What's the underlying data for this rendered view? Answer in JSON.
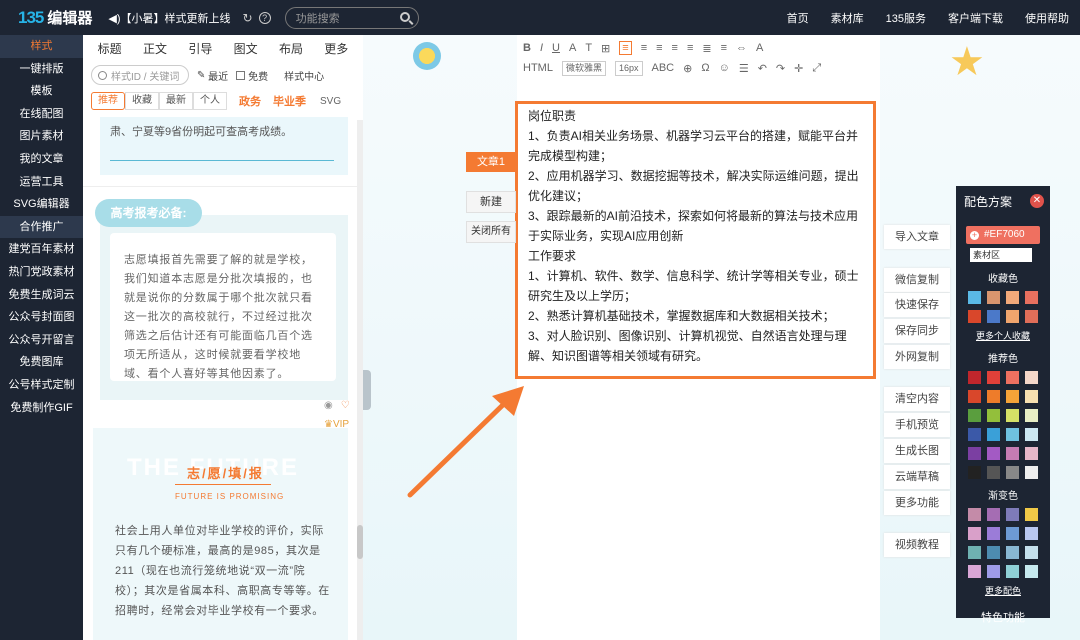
{
  "topbar": {
    "logo_mark": "135",
    "logo_text": "编辑器",
    "notice": "◀)【小暑】样式更新上线",
    "refresh": "↻",
    "help": "?",
    "search_placeholder": "功能搜索",
    "nav": [
      "首页",
      "素材库",
      "135服务",
      "客户端下载",
      "使用帮助"
    ]
  },
  "leftnav": [
    "样式",
    "一键排版",
    "模板",
    "在线配图",
    "图片素材",
    "我的文章",
    "运营工具",
    "SVG编辑器",
    "合作推广",
    "建党百年素材",
    "热门党政素材",
    "免费生成词云",
    "公众号封面图",
    "公众号开留言",
    "免费图库",
    "公号样式定制",
    "免费制作GIF"
  ],
  "panel": {
    "tabs": [
      "标题",
      "正文",
      "引导",
      "图文",
      "布局",
      "更多"
    ],
    "search_placeholder": "样式ID / 关键词",
    "recent": "最近",
    "free": "免费",
    "center": "样式中心",
    "filters": [
      "推荐",
      "收藏",
      "最新",
      "个人"
    ],
    "filter_a": "政务",
    "filter_b": "毕业季",
    "filter_c": "SVG",
    "card1_text": "肃、宁夏等9省份明起可查高考成绩。",
    "badge": "高考报考必备:",
    "card2_text": "志愿填报首先需要了解的就是学校，我们知道本志愿是分批次填报的，也就是说你的分数属于哪个批次就只看这一批次的高校就行，不过经过批次筛选之后估计还有可能面临几百个选项无所适从，这时候就要看学校地域、看个人喜好等其他因素了。",
    "vip": "VIP",
    "card3_big": "THE FUTURE",
    "card3_title": "志/愿/填/报",
    "card3_sub": "FUTURE IS PROMISING",
    "card3_text": "社会上用人单位对毕业学校的评价，实际只有几个硬标准，最高的是985，其次是211（现在也流行笼统地说“双一流”院校）；其次是省属本科、高职高专等等。在招聘时，经常会对毕业学校有一个要求。"
  },
  "toolbar": {
    "row1": [
      "B",
      "I",
      "U",
      "A",
      "T",
      "⊞",
      "≡",
      "≡",
      "≡",
      "≡",
      "≡",
      "≣",
      "≡",
      "⇔",
      "A"
    ],
    "font_select": "微软雅黑",
    "size_select": "16px",
    "row2": [
      "ABC",
      "HTML",
      "⊕",
      "Ω",
      "☺",
      "☰",
      "↶",
      "↷",
      "✛",
      "⤢"
    ]
  },
  "editor": {
    "lines": [
      "岗位职责",
      "1、负责AI相关业务场景、机器学习云平台的搭建，赋能平台并完成模型构建；",
      "2、应用机器学习、数据挖掘等技术，解决实际运维问题，提出优化建议；",
      "3、跟踪最新的AI前沿技术，探索如何将最新的算法与技术应用于实际业务，实现AI应用创新",
      "工作要求",
      "1、计算机、软件、数学、信息科学、统计学等相关专业，硕士研究生及以上学历；",
      "2、熟悉计算机基础技术，掌握数据库和大数据相关技术；",
      "3、对人脸识别、图像识别、计算机视觉、自然语言处理与理解、知识图谱等相关领域有研究。"
    ]
  },
  "article": {
    "tab": "文章1",
    "new": "新建",
    "close_all": "关闭所有"
  },
  "right_buttons": [
    "导入文章",
    "微信复制",
    "快速保存",
    "保存同步",
    "外网复制",
    "清空内容",
    "手机预览",
    "生成长图",
    "云端草稿",
    "更多功能",
    "视频教程"
  ],
  "color_panel": {
    "title": "配色方案",
    "close": "✕",
    "value": "#EF7060",
    "plus": "+",
    "select": "素材区",
    "collect": "收藏色",
    "more_collect": "更多个人收藏",
    "recommend": "推荐色",
    "gradient": "渐变色",
    "more_colors": "更多配色",
    "special": "特色功能",
    "collect_colors": [
      "#5ab9e6",
      "#d9956e",
      "#f2a97a",
      "#e8705f",
      "#d9472b",
      "#4b79c9",
      "#f0a56d",
      "#e06e59"
    ],
    "recommend_colors": [
      "#c0262c",
      "#e14039",
      "#ef7060",
      "#f4d7c9",
      "#d9472b",
      "#ee7c2a",
      "#f4a338",
      "#f7e0b0",
      "#5a9e3e",
      "#93bf3b",
      "#d5e066",
      "#e8eec4",
      "#3b59a8",
      "#3aa0d8",
      "#6fc1e0",
      "#cde8f2",
      "#7b3fa2",
      "#a35ac4",
      "#c67cb3",
      "#e7b7c9",
      "#222222",
      "#555555",
      "#888888",
      "#eeeeee"
    ],
    "gradient_colors": [
      "#c48ba8",
      "#a56db3",
      "#7e7bb9",
      "#f0c947",
      "#d9a0c9",
      "#9b7cd8",
      "#6d9ad4",
      "#b9c8f0",
      "#6fb1b1",
      "#4d8cb0",
      "#89b7d3",
      "#c5e0ec",
      "#d9a6d6",
      "#9e9be8",
      "#8fd0d6",
      "#c6e9ef"
    ]
  }
}
